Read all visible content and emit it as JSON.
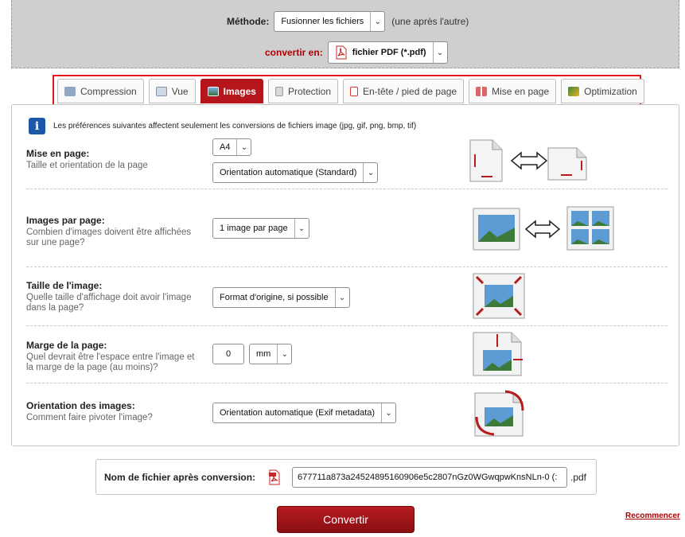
{
  "top": {
    "method_label": "Méthode:",
    "method_value": "Fusionner les fichiers",
    "method_note": "(une après l'autre)",
    "convert_label": "convertir en:",
    "convert_value": "fichier PDF (*.pdf)"
  },
  "tabs": [
    {
      "label": "Compression",
      "icon": "compression-icon",
      "active": false
    },
    {
      "label": "Vue",
      "icon": "view-icon",
      "active": false
    },
    {
      "label": "Images",
      "icon": "image-icon",
      "active": true
    },
    {
      "label": "Protection",
      "icon": "lock-icon",
      "active": false
    },
    {
      "label": "En-tête / pied de page",
      "icon": "header-footer-icon",
      "active": false
    },
    {
      "label": "Mise en page",
      "icon": "layout-icon",
      "active": false
    },
    {
      "label": "Optimization",
      "icon": "optimization-icon",
      "active": false
    }
  ],
  "info": "Les préférences suivantes affectent seulement les conversions de fichiers image (jpg, gif, png, bmp, tif)",
  "sections": {
    "layout": {
      "title": "Mise en page:",
      "desc": "Taille et orientation de la page",
      "page_size": "A4",
      "orientation": "Orientation automatique (Standard)"
    },
    "per_page": {
      "title": "Images par page:",
      "desc": "Combien d'images doivent être affichées sur une page?",
      "value": "1 image par page"
    },
    "size": {
      "title": "Taille de l'image:",
      "desc": "Quelle taille d'affichage doit avoir l'image dans la page?",
      "value": "Format d'origine, si possible"
    },
    "margin": {
      "title": "Marge de la page:",
      "desc": "Quel devrait être l'espace entre l'image et la marge de la page (au moins)?",
      "value": "0",
      "unit": "mm"
    },
    "rotation": {
      "title": "Orientation des images:",
      "desc": "Comment faire pivoter l'image?",
      "value": "Orientation automatique (Exif metadata)"
    }
  },
  "filename": {
    "label": "Nom de fichier après conversion:",
    "value": "677711a873a24524895160906e5c2807nGz0WGwqpwKnsNLn-0 (:",
    "ext": ".pdf"
  },
  "convert_button": "Convertir",
  "restart_link": "Recommencer",
  "colors": {
    "accent": "#b5161b",
    "highlight": "#e0161b"
  }
}
